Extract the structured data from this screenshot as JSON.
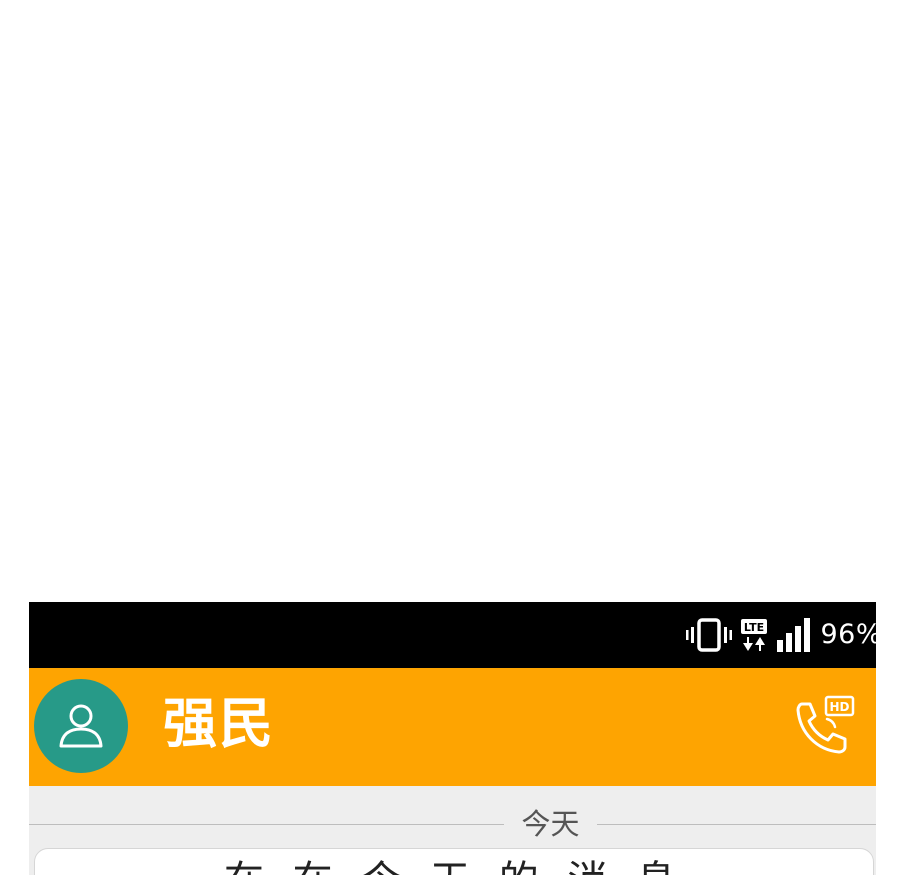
{
  "status_bar": {
    "battery_percent": "96%",
    "network_label": "LTE",
    "icons": [
      "vibrate-icon",
      "lte-data-icon",
      "signal-icon"
    ]
  },
  "app_bar": {
    "contact_name": "强民",
    "background_color": "#fea401",
    "avatar_color": "#279a88",
    "call_badge": "HD"
  },
  "conversation": {
    "date_separator": "今天",
    "message_preview": "在 在 今 天 的 消 息"
  }
}
